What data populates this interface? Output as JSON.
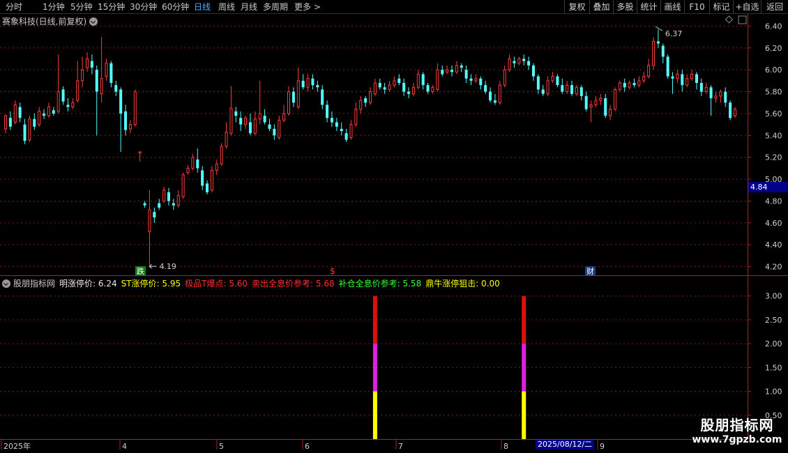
{
  "toolbar": {
    "periods": [
      "分时",
      "1分钟",
      "5分钟",
      "15分钟",
      "30分钟",
      "60分钟",
      "日线",
      "周线",
      "月线",
      "多周期",
      "更多 >"
    ],
    "active_period": "日线",
    "right_buttons": [
      "复权",
      "叠加",
      "多股",
      "统计",
      "画线",
      "F10",
      "标记",
      "+自选",
      "返回"
    ]
  },
  "stock": {
    "title": "赛象科技(日线,前复权)"
  },
  "price_axis": [
    "6.40",
    "6.20",
    "6.00",
    "5.80",
    "5.60",
    "5.40",
    "5.20",
    "5.00",
    "4.80",
    "4.60",
    "4.40",
    "4.20"
  ],
  "cursor_price": "4.84",
  "annotations": {
    "high": "6.37",
    "low": "4.19",
    "tag_die": "跌",
    "tag_money": "$",
    "tag_cai": "财"
  },
  "indicator": {
    "name": "股朋指标网",
    "items": [
      {
        "label": "明涨停价: 6.24",
        "color": "#e8e8e8"
      },
      {
        "label": "ST涨停价: 5.95",
        "color": "#ffff00"
      },
      {
        "label": "极品T爆点: 5.60",
        "color": "#ff3030"
      },
      {
        "label": "卖出全息价参考: 5.68",
        "color": "#ff3030"
      },
      {
        "label": "补仓全息价参考: 5.58",
        "color": "#33ff33"
      },
      {
        "label": "鼎牛涨停狙击: 0.00",
        "color": "#ffff00"
      }
    ],
    "axis": [
      "3.00",
      "2.50",
      "2.00",
      "1.50",
      "1.00",
      "0.50"
    ]
  },
  "date_axis": [
    "2025年",
    "4",
    "5",
    "6",
    "7",
    "8",
    "9"
  ],
  "cursor_date": "2025/08/12/二",
  "watermark": {
    "brand": "股朋指标网",
    "url": "www.7gpzb.com"
  },
  "colors": {
    "up": "#ff3c3c",
    "down": "#54ffff",
    "grid": "#7a1a1a",
    "axis": "#b01e1e",
    "bar_yellow": "#ffff00",
    "bar_magenta": "#e020e0",
    "bar_red": "#dd1010"
  },
  "chart_data": {
    "type": "candlestick",
    "ylim": [
      4.14,
      6.46
    ],
    "indicator_ylim": [
      0,
      3.2
    ],
    "candles": [
      [
        5.46,
        5.58,
        5.59,
        5.42
      ],
      [
        5.56,
        5.48,
        5.62,
        5.45
      ],
      [
        5.52,
        5.68,
        5.72,
        5.5
      ],
      [
        5.66,
        5.56,
        5.7,
        5.52
      ],
      [
        5.5,
        5.35,
        5.55,
        5.32
      ],
      [
        5.36,
        5.55,
        5.58,
        5.34
      ],
      [
        5.55,
        5.48,
        5.6,
        5.45
      ],
      [
        5.5,
        5.62,
        5.66,
        5.48
      ],
      [
        5.6,
        5.58,
        5.64,
        5.55
      ],
      [
        5.58,
        5.66,
        5.7,
        5.56
      ],
      [
        5.63,
        5.6,
        5.66,
        5.58
      ],
      [
        5.62,
        5.8,
        6.14,
        5.6
      ],
      [
        5.82,
        5.71,
        5.85,
        5.68
      ],
      [
        5.68,
        5.66,
        5.74,
        5.62
      ],
      [
        5.66,
        5.7,
        5.74,
        5.64
      ],
      [
        5.72,
        5.9,
        6.08,
        5.7
      ],
      [
        5.9,
        6.0,
        6.12,
        5.84
      ],
      [
        6.02,
        6.1,
        6.16,
        5.98
      ],
      [
        6.08,
        6.02,
        6.14,
        5.96
      ],
      [
        6.0,
        5.8,
        6.04,
        5.4
      ],
      [
        5.78,
        5.92,
        6.3,
        5.7
      ],
      [
        5.94,
        6.06,
        6.1,
        5.9
      ],
      [
        6.06,
        5.88,
        6.08,
        5.84
      ],
      [
        5.86,
        5.8,
        5.9,
        5.76
      ],
      [
        5.82,
        5.6,
        5.84,
        5.25
      ],
      [
        5.62,
        5.45,
        5.68,
        5.4
      ],
      [
        5.46,
        5.5,
        5.54,
        5.42
      ],
      [
        5.5,
        5.8,
        5.82,
        5.48
      ],
      [
        5.24,
        5.25,
        5.25,
        5.16
      ],
      [
        4.78,
        4.76,
        4.8,
        4.74
      ],
      [
        4.52,
        4.72,
        4.9,
        4.19
      ],
      [
        4.7,
        4.65,
        4.74,
        4.6
      ],
      [
        4.78,
        4.74,
        4.82,
        4.72
      ],
      [
        4.8,
        4.9,
        4.93,
        4.78
      ],
      [
        4.88,
        4.8,
        4.92,
        4.76
      ],
      [
        4.78,
        4.76,
        4.82,
        4.72
      ],
      [
        4.76,
        4.85,
        4.9,
        4.74
      ],
      [
        4.84,
        5.04,
        5.06,
        4.82
      ],
      [
        5.06,
        5.1,
        5.13,
        5.04
      ],
      [
        5.1,
        5.2,
        5.23,
        5.08
      ],
      [
        5.18,
        5.1,
        5.28,
        5.06
      ],
      [
        5.08,
        4.94,
        5.12,
        4.9
      ],
      [
        4.96,
        4.88,
        4.99,
        4.86
      ],
      [
        4.9,
        5.08,
        5.12,
        4.88
      ],
      [
        5.08,
        5.14,
        5.18,
        5.04
      ],
      [
        5.14,
        5.3,
        5.33,
        5.12
      ],
      [
        5.3,
        5.43,
        5.52,
        5.28
      ],
      [
        5.42,
        5.65,
        5.85,
        5.4
      ],
      [
        5.62,
        5.58,
        5.66,
        5.52
      ],
      [
        5.56,
        5.5,
        5.62,
        5.44
      ],
      [
        5.5,
        5.56,
        5.58,
        5.46
      ],
      [
        5.52,
        5.42,
        5.6,
        5.4
      ],
      [
        5.42,
        5.55,
        5.62,
        5.4
      ],
      [
        5.55,
        5.6,
        5.9,
        5.5
      ],
      [
        5.58,
        5.52,
        5.64,
        5.5
      ],
      [
        5.5,
        5.46,
        5.55,
        5.44
      ],
      [
        5.46,
        5.4,
        5.5,
        5.36
      ],
      [
        5.38,
        5.54,
        5.58,
        5.36
      ],
      [
        5.54,
        5.6,
        5.68,
        5.52
      ],
      [
        5.6,
        5.8,
        5.85,
        5.58
      ],
      [
        5.8,
        5.7,
        5.84,
        5.66
      ],
      [
        5.66,
        5.9,
        6.02,
        5.64
      ],
      [
        5.9,
        5.84,
        5.96,
        5.82
      ],
      [
        5.84,
        5.92,
        5.96,
        5.8
      ],
      [
        5.92,
        5.86,
        5.96,
        5.82
      ],
      [
        5.86,
        5.84,
        5.9,
        5.8
      ],
      [
        5.82,
        5.68,
        5.86,
        5.64
      ],
      [
        5.68,
        5.56,
        5.72,
        5.52
      ],
      [
        5.56,
        5.52,
        5.62,
        5.48
      ],
      [
        5.52,
        5.48,
        5.56,
        5.44
      ],
      [
        5.46,
        5.44,
        5.52,
        5.4
      ],
      [
        5.42,
        5.36,
        5.46,
        5.34
      ],
      [
        5.38,
        5.5,
        5.54,
        5.36
      ],
      [
        5.5,
        5.64,
        5.7,
        5.48
      ],
      [
        5.64,
        5.72,
        5.76,
        5.6
      ],
      [
        5.74,
        5.7,
        5.76,
        5.66
      ],
      [
        5.7,
        5.8,
        5.84,
        5.68
      ],
      [
        5.78,
        5.88,
        5.92,
        5.76
      ],
      [
        5.88,
        5.84,
        5.92,
        5.82
      ],
      [
        5.84,
        5.82,
        5.88,
        5.78
      ],
      [
        5.82,
        5.86,
        5.9,
        5.8
      ],
      [
        5.86,
        5.9,
        5.94,
        5.84
      ],
      [
        5.92,
        5.88,
        5.96,
        5.86
      ],
      [
        5.88,
        5.8,
        5.92,
        5.76
      ],
      [
        5.8,
        5.78,
        5.84,
        5.74
      ],
      [
        5.78,
        5.84,
        5.88,
        5.76
      ],
      [
        5.84,
        5.96,
        6.0,
        5.82
      ],
      [
        5.96,
        5.86,
        5.98,
        5.82
      ],
      [
        5.86,
        5.8,
        5.88,
        5.78
      ],
      [
        5.8,
        5.84,
        5.86,
        5.78
      ],
      [
        5.82,
        6.0,
        6.06,
        5.8
      ],
      [
        6.0,
        5.96,
        6.04,
        5.94
      ],
      [
        5.98,
        6.0,
        6.04,
        5.96
      ],
      [
        6.0,
        5.98,
        6.04,
        5.94
      ],
      [
        5.98,
        6.04,
        6.08,
        5.96
      ],
      [
        6.04,
        6.02,
        6.06,
        5.98
      ],
      [
        6.0,
        5.92,
        6.04,
        5.88
      ],
      [
        5.92,
        5.9,
        5.96,
        5.86
      ],
      [
        5.9,
        5.92,
        5.96,
        5.88
      ],
      [
        5.92,
        5.86,
        5.94,
        5.82
      ],
      [
        5.86,
        5.8,
        5.9,
        5.78
      ],
      [
        5.8,
        5.72,
        5.84,
        5.7
      ],
      [
        5.72,
        5.7,
        5.78,
        5.68
      ],
      [
        5.7,
        5.86,
        5.9,
        5.68
      ],
      [
        5.86,
        6.0,
        6.04,
        5.84
      ],
      [
        6.0,
        6.1,
        6.14,
        5.98
      ],
      [
        6.08,
        6.06,
        6.12,
        6.02
      ],
      [
        6.06,
        6.1,
        6.12,
        6.04
      ],
      [
        6.1,
        6.08,
        6.14,
        6.04
      ],
      [
        6.08,
        6.04,
        6.12,
        6.0
      ],
      [
        6.04,
        5.94,
        6.06,
        5.9
      ],
      [
        5.94,
        5.82,
        5.96,
        5.78
      ],
      [
        5.82,
        5.78,
        5.86,
        5.76
      ],
      [
        5.78,
        5.9,
        5.94,
        5.76
      ],
      [
        5.9,
        5.94,
        5.98,
        5.88
      ],
      [
        5.94,
        5.86,
        5.96,
        5.84
      ],
      [
        5.86,
        5.8,
        5.92,
        5.78
      ],
      [
        5.8,
        5.86,
        5.9,
        5.78
      ],
      [
        5.86,
        5.78,
        5.9,
        5.76
      ],
      [
        5.78,
        5.84,
        5.86,
        5.76
      ],
      [
        5.84,
        5.76,
        5.86,
        5.72
      ],
      [
        5.76,
        5.64,
        5.8,
        5.62
      ],
      [
        5.66,
        5.68,
        5.72,
        5.52
      ],
      [
        5.68,
        5.72,
        5.76,
        5.66
      ],
      [
        5.72,
        5.74,
        5.78,
        5.68
      ],
      [
        5.74,
        5.58,
        5.78,
        5.56
      ],
      [
        5.58,
        5.64,
        5.68,
        5.54
      ],
      [
        5.64,
        5.82,
        5.84,
        5.62
      ],
      [
        5.82,
        5.88,
        5.9,
        5.8
      ],
      [
        5.88,
        5.84,
        5.92,
        5.8
      ],
      [
        5.84,
        5.88,
        5.9,
        5.82
      ],
      [
        5.88,
        5.86,
        5.92,
        5.84
      ],
      [
        5.86,
        5.9,
        5.94,
        5.84
      ],
      [
        5.9,
        5.94,
        5.98,
        5.88
      ],
      [
        5.94,
        6.04,
        6.1,
        5.92
      ],
      [
        6.04,
        6.26,
        6.3,
        6.0
      ],
      [
        6.26,
        6.24,
        6.37,
        6.2
      ],
      [
        6.22,
        6.12,
        6.24,
        6.06
      ],
      [
        6.12,
        5.94,
        6.14,
        5.92
      ],
      [
        5.94,
        5.92,
        5.98,
        5.78
      ],
      [
        5.92,
        5.96,
        6.0,
        5.88
      ],
      [
        5.96,
        5.86,
        6.0,
        5.8
      ],
      [
        5.86,
        5.92,
        5.96,
        5.84
      ],
      [
        5.92,
        5.96,
        6.0,
        5.9
      ],
      [
        5.96,
        5.88,
        5.98,
        5.82
      ],
      [
        5.88,
        5.8,
        5.92,
        5.76
      ],
      [
        5.8,
        5.84,
        5.88,
        5.78
      ],
      [
        5.84,
        5.74,
        5.86,
        5.58
      ],
      [
        5.74,
        5.76,
        5.8,
        5.7
      ],
      [
        5.76,
        5.8,
        5.82,
        5.7
      ],
      [
        5.8,
        5.7,
        5.84,
        5.66
      ],
      [
        5.7,
        5.56,
        5.72,
        5.54
      ],
      [
        5.58,
        5.64,
        5.66,
        5.56
      ]
    ],
    "indicator_bars": [
      {
        "index": 77,
        "values": [
          1,
          2,
          3
        ]
      },
      {
        "index": 108,
        "values": [
          1,
          2,
          3
        ]
      }
    ]
  }
}
